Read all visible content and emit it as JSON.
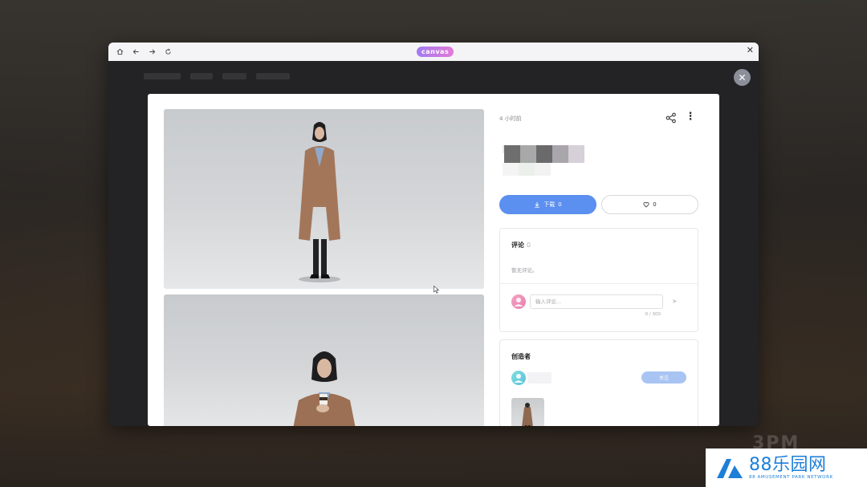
{
  "browser": {
    "brand": "canvas",
    "home_icon": "home-icon",
    "back_icon": "arrow-left-icon",
    "forward_icon": "arrow-right-icon",
    "refresh_icon": "refresh-icon",
    "close_icon": "close-icon"
  },
  "detail": {
    "time_ago": "4 小时前",
    "download_label": "下载",
    "download_count": "0",
    "like_count": "0"
  },
  "comments": {
    "title": "评论",
    "count": "0",
    "empty_text": "暂无评论。",
    "input_placeholder": "输入评论...",
    "char_counter": "0 / 300"
  },
  "creator": {
    "title": "创造者",
    "follow_label": "关注"
  },
  "watermark": {
    "main": "88乐园网",
    "sub": "88 AMUSEMENT PARK NETWORK",
    "ghost": "3PM"
  },
  "colors": {
    "primary": "#5b8ff0",
    "follow": "#a8c4f2",
    "brand_start": "#a27bf0",
    "brand_end": "#e27ad8",
    "watermark": "#1d7fd8"
  }
}
